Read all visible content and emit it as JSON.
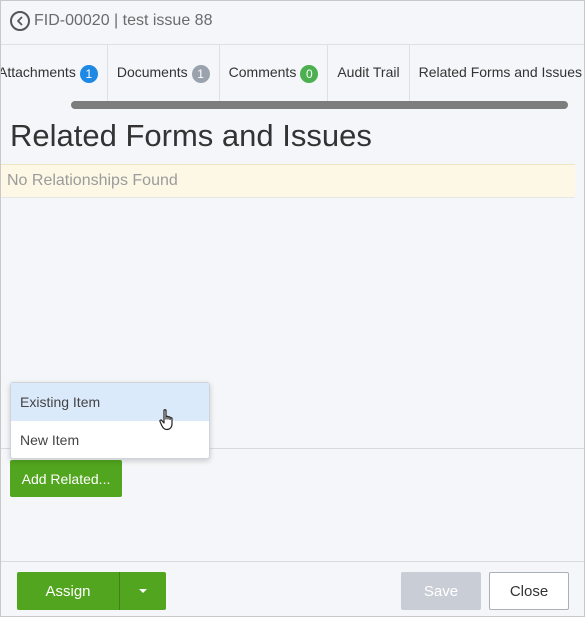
{
  "header": {
    "title": "FID-00020 | test issue 88"
  },
  "tabs": [
    {
      "label": "Attachments",
      "badge": "1",
      "badge_color": "#1e88e5"
    },
    {
      "label": "Documents",
      "badge": "1",
      "badge_color": "#9aa3ad"
    },
    {
      "label": "Comments",
      "badge": "0",
      "badge_color": "#4caf50"
    },
    {
      "label": "Audit Trail",
      "badge": null
    },
    {
      "label": "Related Forms and Issues",
      "badge": "",
      "badge_color": "#26a06b"
    }
  ],
  "section": {
    "title": "Related Forms and Issues",
    "notice": "No Relationships Found"
  },
  "dropdown": {
    "items": [
      "Existing Item",
      "New Item"
    ],
    "hovered": "Existing Item"
  },
  "actions": {
    "add_related_label": "Add Related..."
  },
  "footer": {
    "assign_label": "Assign",
    "save_label": "Save",
    "close_label": "Close"
  },
  "colors": {
    "primary_green": "#52a51e",
    "disabled": "#c9ced6",
    "notice_bg": "#fdf8e6"
  }
}
